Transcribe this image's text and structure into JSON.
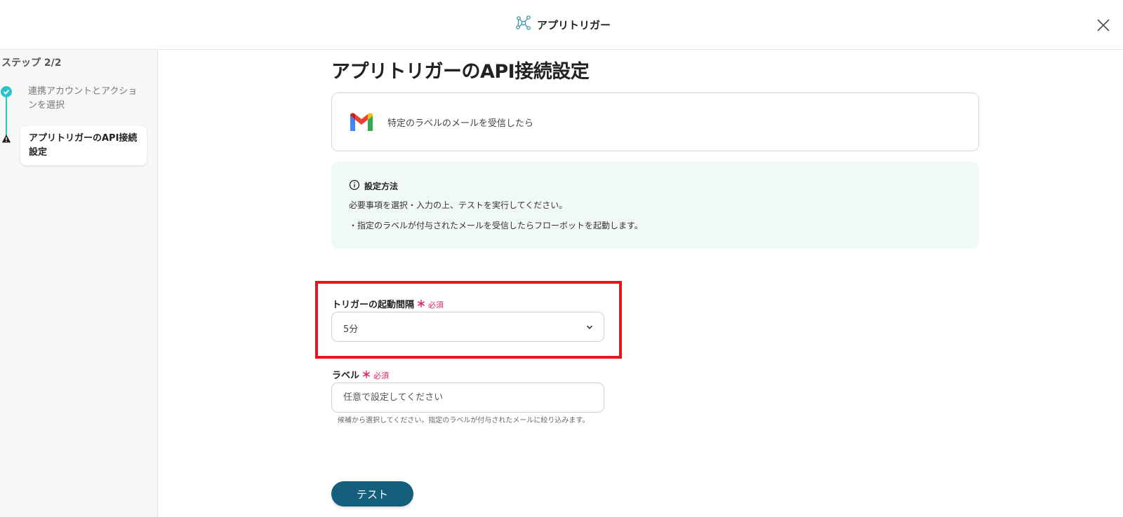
{
  "header": {
    "title": "アプリトリガー",
    "app_icon": "network-nodes-icon",
    "close_icon": "close-icon"
  },
  "sidebar": {
    "step_title": "ステップ 2/2",
    "steps": [
      {
        "label": "連携アカウントとアクションを選択",
        "status": "complete",
        "icon": "check-icon"
      },
      {
        "label": "アプリトリガーのAPI接続設定",
        "status": "active-warning",
        "icon": "warning-icon"
      }
    ]
  },
  "main": {
    "title": "アプリトリガーのAPI接続設定",
    "app_card": {
      "icon": "gmail-icon",
      "text": "特定のラベルのメールを受信したら"
    },
    "info": {
      "icon": "info-icon",
      "heading": "設定方法",
      "line1": "必要事項を選択・入力の上、テストを実行してください。",
      "line2": "・指定のラベルが付与されたメールを受信したらフローボットを起動します。"
    },
    "interval_field": {
      "label": "トリガーの起動間隔",
      "required_mark": "＊",
      "required_text": "必須",
      "selected_value": "5分"
    },
    "label_field": {
      "label": "ラベル",
      "required_mark": "＊",
      "required_text": "必須",
      "placeholder": "任意で設定してください",
      "help": "候補から選択してください。指定のラベルが付与されたメールに絞り込みます。"
    },
    "test_button": "テスト"
  },
  "colors": {
    "accent_teal": "#2bc3c7",
    "button": "#155f7c",
    "highlight": "#e3171b",
    "required": "#e0245e",
    "info_bg": "#f0f9f7"
  }
}
